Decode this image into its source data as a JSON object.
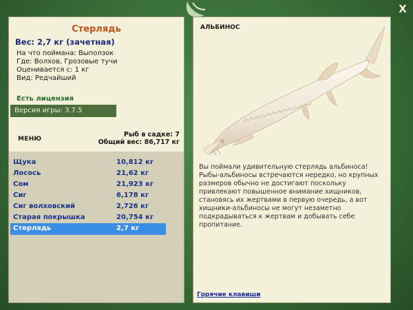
{
  "window": {
    "close_label": "X"
  },
  "fish": {
    "title": "Стерлядь",
    "weight": "Вес: 2,7 кг (зачетная)",
    "bait": "На что поймана: Выползок",
    "location": "Где: Волхов, Грозовые тучи",
    "value": "Оценивается с: 1 кг",
    "kind": "Вид: Редчайший"
  },
  "license": "Есть лицензия",
  "version": "Версия игры: 3.7.5",
  "menu_label": "МЕНЮ",
  "keepnet": {
    "count": "Рыб в садке: 7",
    "total": "Общий вес: 86,717 кг"
  },
  "catch_list": [
    {
      "name": "Щука",
      "weight": "10,812 кг"
    },
    {
      "name": "Лосось",
      "weight": "21,62 кг"
    },
    {
      "name": "Сом",
      "weight": "21,923 кг"
    },
    {
      "name": "Сиг",
      "weight": "6,178 кг"
    },
    {
      "name": "Сиг волховский",
      "weight": "2,726 кг"
    },
    {
      "name": "Старая покрышка",
      "weight": "20,754 кг"
    },
    {
      "name": "Стерлядь",
      "weight": "2,7 кг"
    }
  ],
  "selected_index": 6,
  "albino_label": "АЛЬБИНОС",
  "description": "Вы поймали удивительную стерлядь альбиноса! Рыбы-альбиносы встречаются нередко, но крупных размеров обычно не достигают поскольку привлекают повышенное внимание хищников, становясь их жертвами в первую очередь, а вот хищники-альбиносы не могут незаметно подкрадываться к жертвам и добывать себе пропитание.",
  "hotkeys": "Горячие клавиши",
  "colors": {
    "accent_title": "#c0501a",
    "selection": "#3a8ee6",
    "frame_green": "#386d37"
  }
}
